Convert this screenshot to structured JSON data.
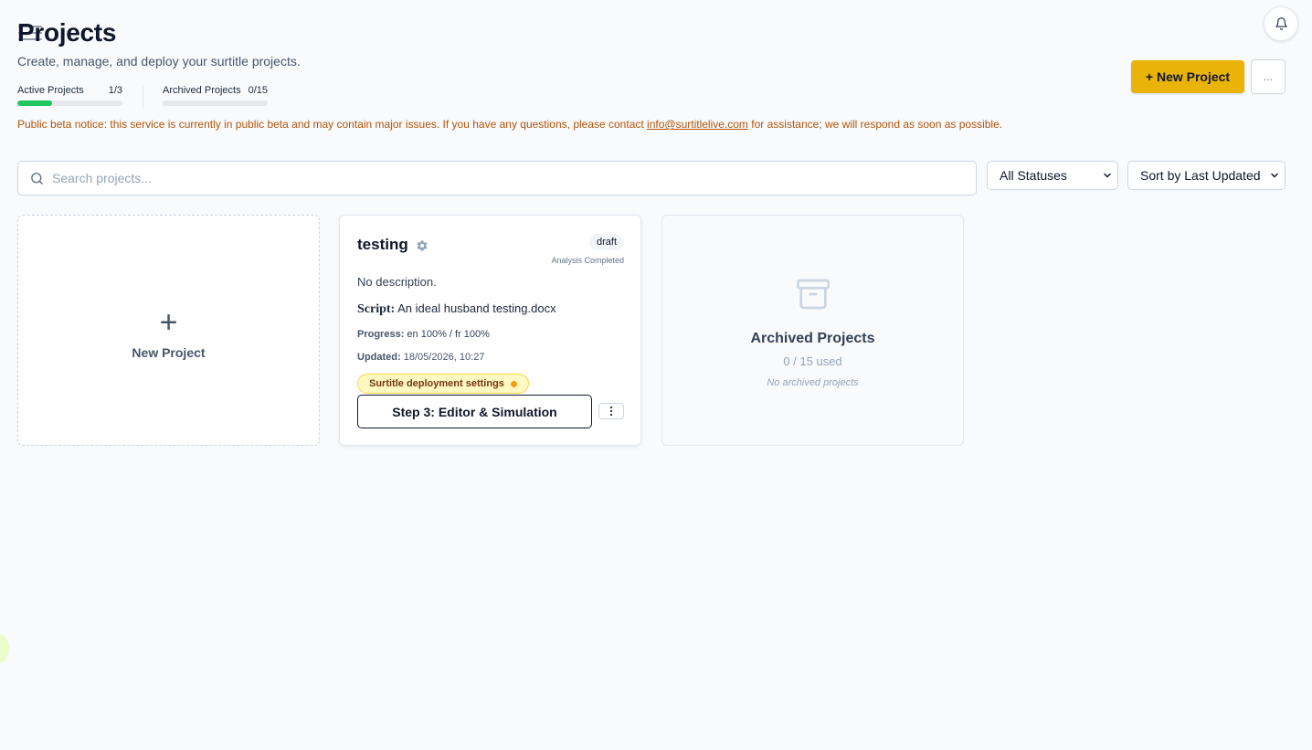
{
  "header": {
    "title": "Projects",
    "subtitle": "Create, manage, and deploy your surtitle projects.",
    "new_project_label": "+ New Project",
    "more_label": "..."
  },
  "stats": {
    "active_label": "Active Projects",
    "active_value": "1/3",
    "active_fraction": 0.3333,
    "archived_label": "Archived Projects",
    "archived_value": "0/15",
    "archived_fraction": 0
  },
  "notice": {
    "prefix": "Public beta notice: this service is currently in public beta and may contain major issues. If you have any questions, please contact ",
    "email": "info@surtitlelive.com",
    "suffix": " for assistance; we will respond as soon as possible."
  },
  "search": {
    "placeholder": "Search projects..."
  },
  "filters": {
    "status": "All Statuses",
    "sort": "Sort by Last Updated"
  },
  "new_card": {
    "plus": "+",
    "label": "New Project"
  },
  "project": {
    "name": "testing",
    "status": "draft",
    "analysis": "Analysis Completed",
    "description": "No description.",
    "script_label": "Script:",
    "script_value": "An ideal husband testing.docx",
    "progress_label": "Progress:",
    "progress_value": "en 100% / fr 100%",
    "updated_label": "Updated:",
    "updated_value": "18/05/2026, 10:27",
    "deploy_label": "Surtitle deployment settings",
    "step_label": "Step 3: Editor & Simulation"
  },
  "archived": {
    "title": "Archived Projects",
    "used": "0 / 15 used",
    "empty": "No archived projects"
  },
  "colors": {
    "accent": "#eab308",
    "progress_green": "#22c55e",
    "notice": "#b45309",
    "deploy_dot": "#f59e0b"
  },
  "icons": [
    "menu-icon",
    "bell-icon",
    "search-icon",
    "chevron-down-icon",
    "plus-icon",
    "gear-icon",
    "archive-icon",
    "kebab-icon"
  ]
}
